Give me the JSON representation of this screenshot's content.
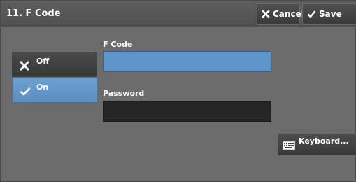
{
  "header": {
    "title": "11. F Code",
    "cancel_label": "Cancel",
    "save_label": "Save"
  },
  "options": {
    "off_label": "Off",
    "on_label": "On",
    "selected": "On"
  },
  "fields": {
    "fcode_label": "F Code",
    "fcode_value": "",
    "password_label": "Password",
    "password_value": ""
  },
  "keyboard": {
    "label": "Keyboard..."
  },
  "colors": {
    "selected_accent": "#5f95cb",
    "background": "#6c6c6c",
    "input_dark": "#262626"
  }
}
